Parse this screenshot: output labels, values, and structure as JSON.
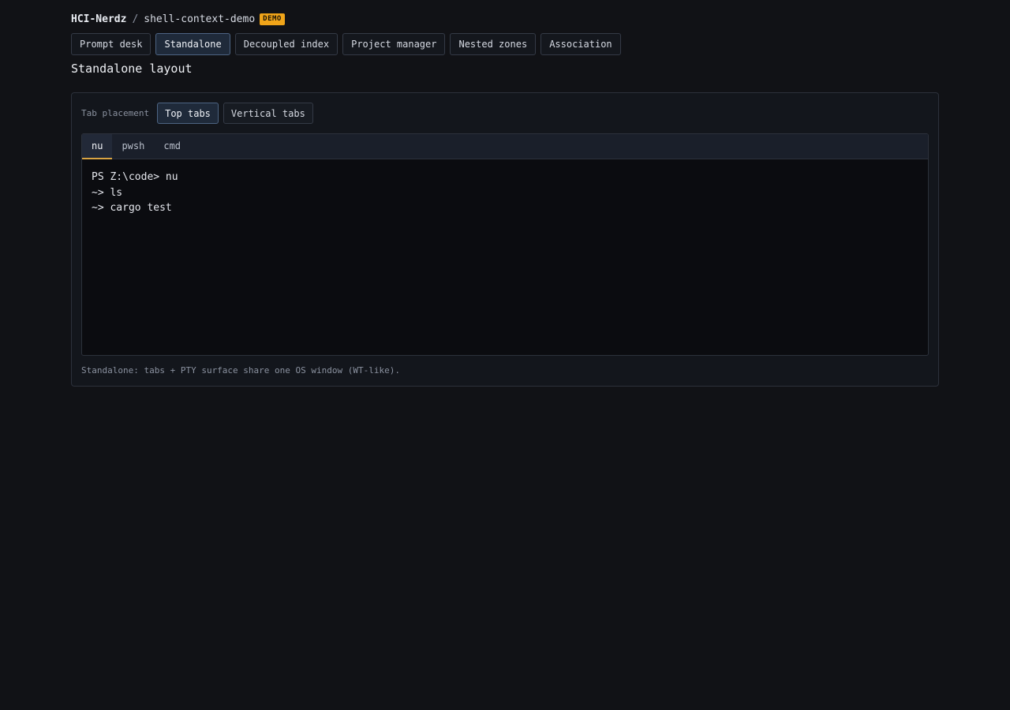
{
  "header": {
    "org": "HCI-Nerdz",
    "separator": "/",
    "repo": "shell-context-demo",
    "badge": "DEMO"
  },
  "nav": {
    "items": [
      {
        "label": "Prompt desk"
      },
      {
        "label": "Standalone"
      },
      {
        "label": "Decoupled index"
      },
      {
        "label": "Project manager"
      },
      {
        "label": "Nested zones"
      },
      {
        "label": "Association"
      }
    ],
    "active": "Standalone"
  },
  "page_title": "Standalone layout",
  "placement": {
    "label": "Tab placement",
    "options": [
      {
        "label": "Top tabs"
      },
      {
        "label": "Vertical tabs"
      }
    ],
    "active": "Top tabs"
  },
  "terminal": {
    "tabs": [
      {
        "label": "nu"
      },
      {
        "label": "pwsh"
      },
      {
        "label": "cmd"
      }
    ],
    "active_tab": "nu",
    "lines": [
      "PS Z:\\code> nu",
      "~> ls",
      "~> cargo test"
    ]
  },
  "footer_note": "Standalone: tabs + PTY surface share one OS window (WT-like).",
  "colors": {
    "background": "#111216",
    "accent_badge": "#f0a419",
    "active_tab_underline": "#d9a443",
    "active_button_border": "#4d6483"
  }
}
